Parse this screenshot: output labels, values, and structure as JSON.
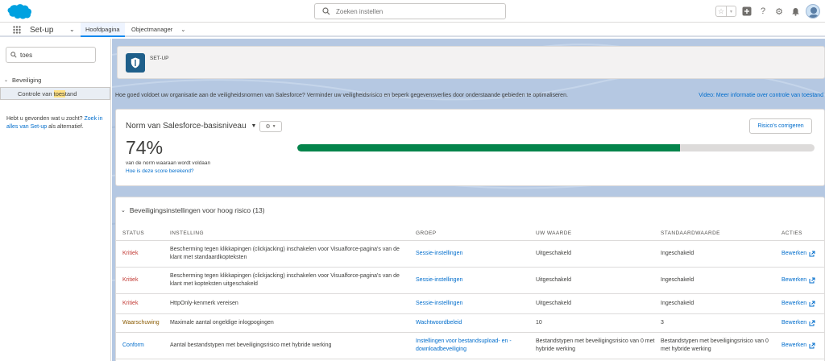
{
  "header": {
    "search_placeholder": "Zoeken instellen"
  },
  "nav": {
    "app_name": "Set-up",
    "tabs": [
      {
        "label": "Hoofdpagina"
      },
      {
        "label": "Objectmanager"
      }
    ]
  },
  "sidebar": {
    "search_value": "toes",
    "group_label": "Beveiliging",
    "item_prefix": "Controle van ",
    "item_highlight": "toes",
    "item_suffix": "tand",
    "help_text_1": "Hebt u gevonden wat u zocht? ",
    "help_link": "Zoek in alles van Set-up",
    "help_text_2": " als alternatief."
  },
  "main": {
    "setup_label": "SET-UP",
    "intro_text": "Hoe goed voldoet uw organisatie aan de veiligheidsnormen van Salesforce? Verminder uw veiligheidsrisico en beperk gegevensverlies door onderstaande gebieden te optimaliseren.",
    "intro_link": "Video: Meer informatie over controle van toestand",
    "score": {
      "norm_title": "Norm van Salesforce-basisniveau",
      "percent_text": "74%",
      "percent_value": 74,
      "subtext": "van de norm waaraan wordt voldaan",
      "help_link": "Hoe is deze score berekend?",
      "fix_button": "Risico's corrigeren",
      "bar_color": "#04844b"
    },
    "section_title": "Beveiligingsinstellingen voor hoog risico (13)",
    "table": {
      "columns": [
        "STATUS",
        "INSTELLING",
        "GROEP",
        "UW WAARDE",
        "STANDAARDWAARDE",
        "ACTIES"
      ],
      "rows": [
        {
          "status": "Kritiek",
          "setting": "Bescherming tegen klikkapingen (clickjacking) inschakelen voor Visualforce-pagina's van de klant met standaardkopteksten",
          "group": "Sessie-instellingen",
          "value": "Uitgeschakeld",
          "default": "Ingeschakeld",
          "action": "Bewerken"
        },
        {
          "status": "Kritiek",
          "setting": "Bescherming tegen klikkapingen (clickjacking) inschakelen voor Visualforce-pagina's van de klant met kopteksten uitgeschakeld",
          "group": "Sessie-instellingen",
          "value": "Uitgeschakeld",
          "default": "Ingeschakeld",
          "action": "Bewerken"
        },
        {
          "status": "Kritiek",
          "setting": "HttpOnly-kenmerk vereisen",
          "group": "Sessie-instellingen",
          "value": "Uitgeschakeld",
          "default": "Ingeschakeld",
          "action": "Bewerken"
        },
        {
          "status": "Waarschuwing",
          "setting": "Maximale aantal ongeldige inlogpogingen",
          "group": "Wachtwoordbeleid",
          "value": "10",
          "default": "3",
          "action": "Bewerken"
        },
        {
          "status": "Conform",
          "setting": "Aantal bestandstypen met beveiligingsrisico met hybride werking",
          "group": "Instellingen voor bestandsupload- en -downloadbeveiliging",
          "value": "Bestandstypen met beveiligingsrisico van 0 met hybride werking",
          "default": "Bestandstypen met beveiligingsrisico van 0 met hybride werking",
          "action": "Bewerken"
        }
      ]
    }
  },
  "colors": {
    "brand_blue": "#00a1e0",
    "link": "#006dcc",
    "critical": "#c23934",
    "warning": "#8a5a00"
  }
}
